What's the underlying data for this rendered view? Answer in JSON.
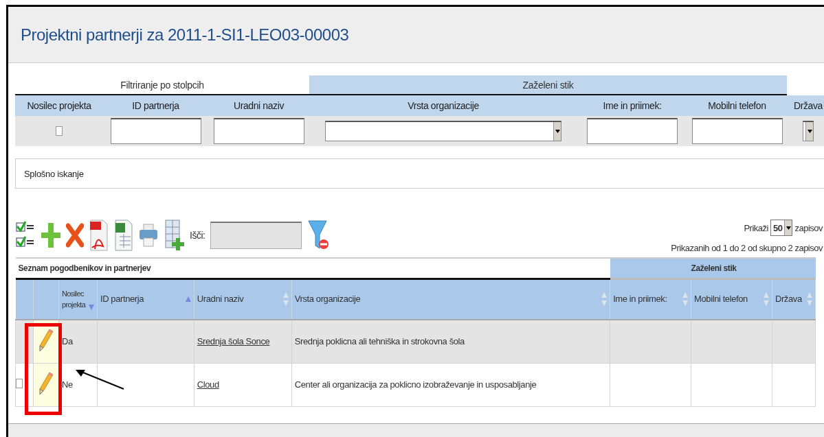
{
  "title": "Projektni partnerji za 2011-1-SI1-LEO03-00003",
  "filter": {
    "caption": "Filtriranje po stolpcih",
    "group_caption": "Zaželeni stik",
    "columns": [
      {
        "label": "Nosilec projekta",
        "kind": "checkbox",
        "checked": false
      },
      {
        "label": "ID partnerja",
        "kind": "text"
      },
      {
        "label": "Uradni naziv",
        "kind": "text"
      },
      {
        "label": "Vrsta organizacije",
        "kind": "select"
      },
      {
        "label": "Ime in priimek:",
        "kind": "text"
      },
      {
        "label": "Mobilni telefon",
        "kind": "text"
      },
      {
        "label": "Država",
        "kind": "select"
      }
    ]
  },
  "general_search": {
    "label": "Splošno iskanje"
  },
  "toolbar": {
    "search_label": "Išči:",
    "page_size_label": "Prikaži",
    "page_size": "50",
    "page_size_suffix": "zapisov",
    "info": "Prikazanih od 1 do 2 od skupno 2 zapisov"
  },
  "list": {
    "caption": "Seznam pogodbenikov in partnerjev",
    "group_caption": "Zaželeni stik",
    "columns": [
      {
        "label": "Nosilec projekta",
        "sorted_ascending": false,
        "sorted_descending": true
      },
      {
        "label": "ID partnerja",
        "sorted_ascending": true,
        "sorted_descending": false
      },
      {
        "label": "Uradni naziv",
        "sorted_ascending": false,
        "sorted_descending": false
      },
      {
        "label": "Vrsta organizacije",
        "sorted_ascending": false,
        "sorted_descending": false
      },
      {
        "label": "Ime in priimek:",
        "sorted_ascending": false,
        "sorted_descending": false
      },
      {
        "label": "Mobilni telefon",
        "sorted_ascending": false,
        "sorted_descending": false
      },
      {
        "label": "Država",
        "sorted_ascending": false,
        "sorted_descending": false
      }
    ],
    "rows": [
      {
        "selected": true,
        "nosilec": "Da",
        "name": "Srednja šola Sonce",
        "type": "Srednja poklicna ali tehniška in strokovna šola"
      },
      {
        "selected": false,
        "checkbox": {
          "checked": false
        },
        "nosilec": "Ne",
        "name": "Cloud",
        "type": "Center ali organizacija za poklicno izobraževanje in usposabljanje"
      }
    ]
  },
  "annotation": {
    "highlight_box": true,
    "arrow": true
  }
}
